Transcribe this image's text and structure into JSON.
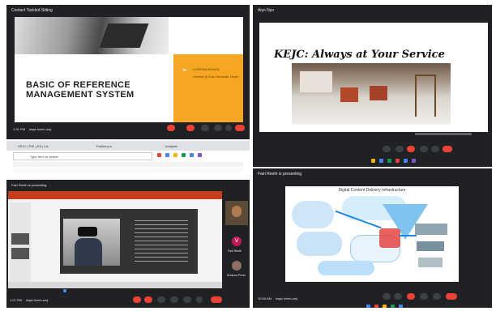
{
  "q1": {
    "window_title": "Contact Tackled Sitting",
    "slide_title_line1": "BASIC OF REFERENCE",
    "slide_title_line2": "MANAGEMENT SYSTEM",
    "presenter_name": "LOREINA BRANN",
    "presenter_subtitle": "Librarian @ Kuan Semanatic Library",
    "time": "1:31 PM",
    "meeting_code": "dwpt-hvmh-uwj"
  },
  "q2": {
    "window_title": "Aiyo Nyo",
    "slide_heading": "KEJC: Always at Your Service"
  },
  "q3": {
    "tab1": "KEJC ( PIE ) ES | Lib",
    "tab2": "Thaiberg in",
    "tab3": "Analysis",
    "search_placeholder": "Type here to search",
    "presenting_label": "Fairi Reeth is presenting",
    "participant1_label": "Fairi Reeth",
    "participant2_label": "Nrusuva Press",
    "avatar_letter": "V",
    "time": "1:07 PM",
    "meeting_code": "dwpt-hvmh-uwj"
  },
  "q4": {
    "presenting_label": "Fairi Reeth is presenting",
    "diagram_title": "Digital Content Delivery Infrastructure",
    "time": "10:34 AM",
    "meeting_code": "dwpt-hvmh-uwj"
  },
  "colors": {
    "meet_bg": "#202124",
    "end_call": "#ea4335",
    "slide_orange": "#f5a623"
  }
}
